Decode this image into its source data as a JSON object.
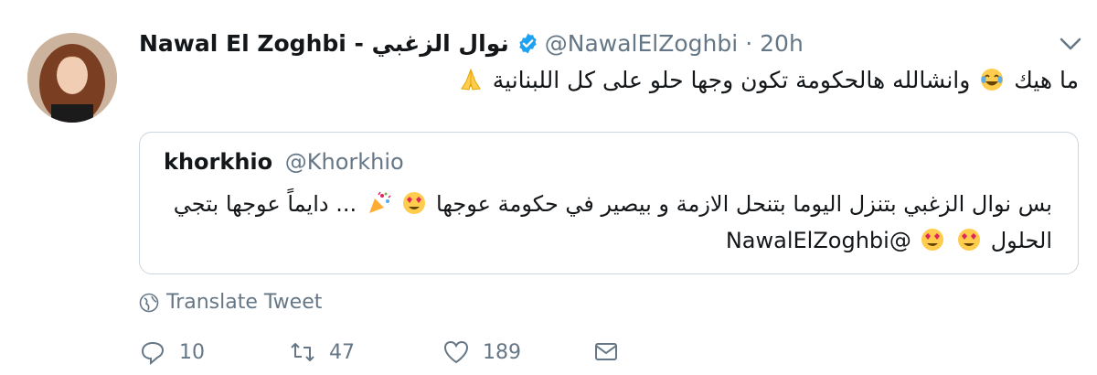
{
  "tweet": {
    "display_name": "Nawal El Zoghbi - نوال الزغبي",
    "handle": "@NawalElZoghbi",
    "separator": "·",
    "time": "20h",
    "text_before": "ما هيك",
    "text_after": "وانشالله هالحكومة تكون وجها حلو على كل اللبنانية",
    "verified": true
  },
  "quote": {
    "display_name": "khorkhio",
    "handle": "@Khorkhio",
    "line1_part1": "بس نوال الزغبي بتنزل اليوما بتنحل الازمة و بيصير في حكومة عوجها",
    "line1_part2": "... دايماً عوجها بتجي",
    "line2_text": "الحلول",
    "mention": "@NawalElZoghbi"
  },
  "translate_label": "Translate Tweet",
  "actions": {
    "reply_count": "10",
    "retweet_count": "47",
    "like_count": "189"
  },
  "colors": {
    "text": "#14171a",
    "muted": "#657786",
    "verified_blue": "#1da1f2",
    "border": "#ccd6dd"
  },
  "icons": [
    "verified-icon",
    "chevron-down-icon",
    "globe-icon",
    "reply-icon",
    "retweet-icon",
    "like-icon",
    "share-icon",
    "laughing-emoji",
    "pray-emoji",
    "confetti-emoji",
    "heart-eyes-emoji"
  ]
}
